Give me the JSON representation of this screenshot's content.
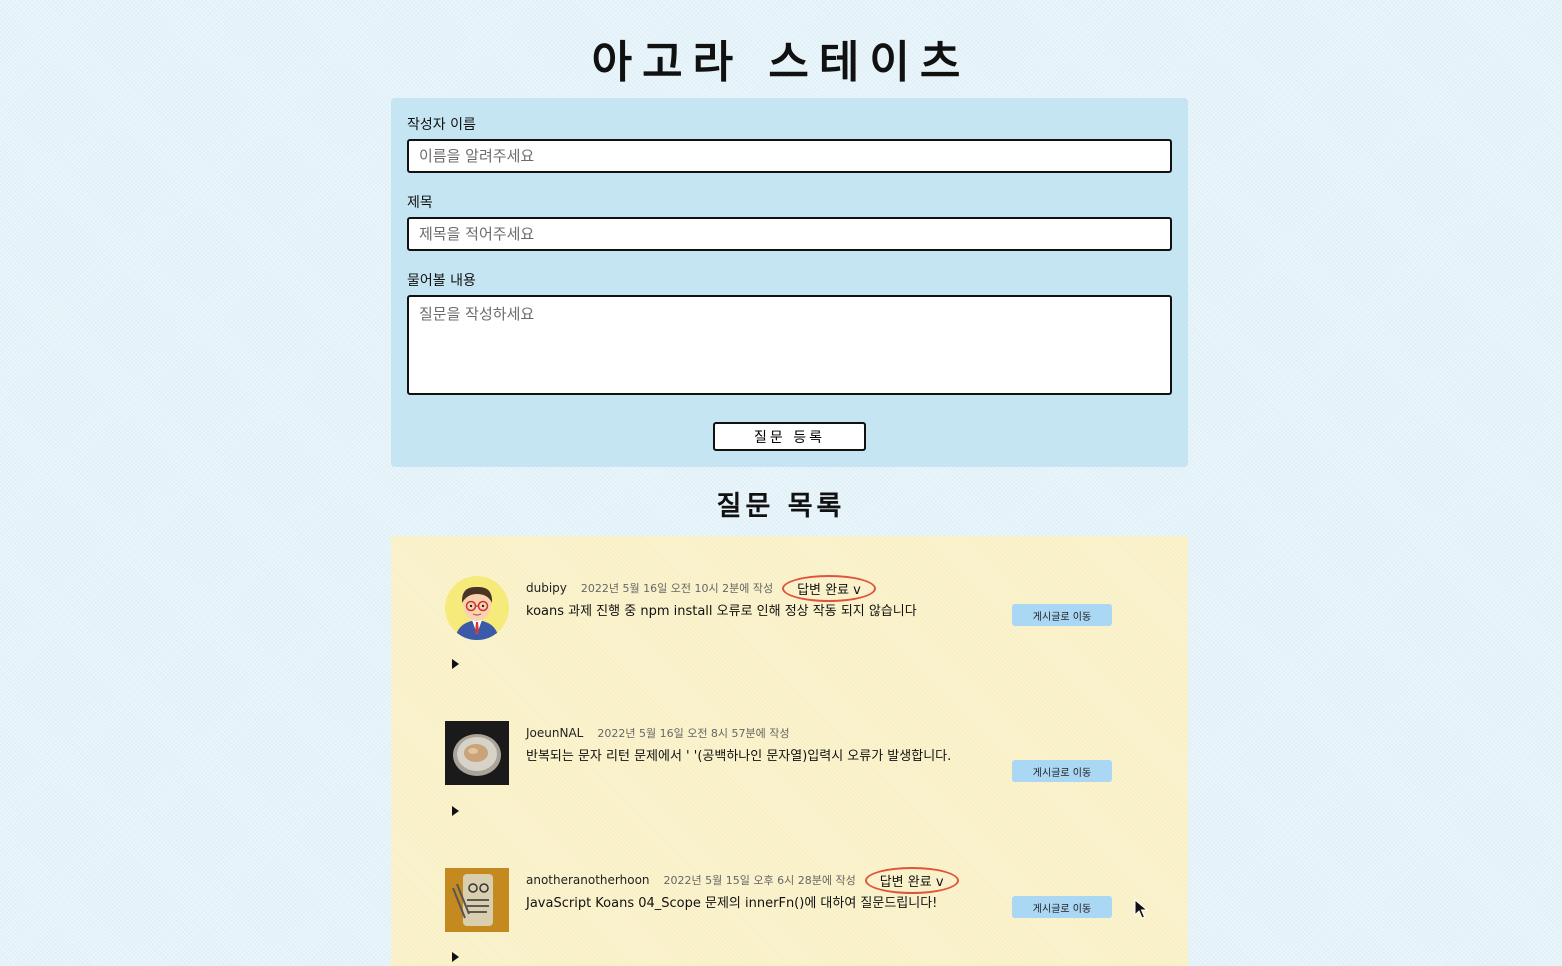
{
  "page": {
    "title": "아고라 스테이츠"
  },
  "form": {
    "author_label": "작성자 이름",
    "author_placeholder": "이름을 알려주세요",
    "title_label": "제목",
    "title_placeholder": "제목을 적어주세요",
    "body_label": "물어볼 내용",
    "body_placeholder": "질문을 작성하세요",
    "submit_label": "질문 등록"
  },
  "list": {
    "title": "질문 목록",
    "items": [
      {
        "author": "dubipy",
        "created_at": "2022년 5월 16일 오전 10시 2분에 작성",
        "answer_badge": "답변 완료 v",
        "title": "koans 과제 진행 중 npm install 오류로 인해 정상 작동 되지 않습니다",
        "goto_label": "게시글로 이동",
        "avatar": "cartoon-man-avatar"
      },
      {
        "author": "JoeunNAL",
        "created_at": "2022년 5월 16일 오전 8시 57분에 작성",
        "answer_badge": "",
        "title": "반복되는 문자 리턴 문제에서 ' '(공백하나인 문자열)입력시 오류가 발생합니다.",
        "goto_label": "게시글로 이동",
        "avatar": "bowl-photo-avatar"
      },
      {
        "author": "anotheranotherhoon",
        "created_at": "2022년 5월 15일 오후 6시 28분에 작성",
        "answer_badge": "답변 완료 v",
        "title": "JavaScript Koans 04_Scope 문제의 innerFn()에 대하여 질문드립니다!",
        "goto_label": "게시글로 이동",
        "avatar": "sketch-drawing-avatar"
      }
    ]
  },
  "colors": {
    "page_bg": "#eaf6fb",
    "form_bg": "#c5e5f3",
    "list_bg": "#fbf3cd",
    "badge_ring": "#e0543c",
    "goto_button": "#a9d7f4"
  }
}
